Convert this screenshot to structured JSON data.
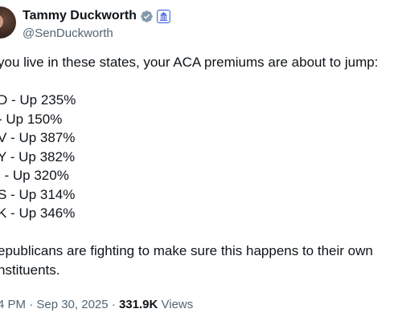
{
  "author": {
    "name": "Tammy Duckworth",
    "handle": "@SenDuckworth"
  },
  "tweet": {
    "intro": "you live in these states, your ACA premiums are about to jump:",
    "states": [
      "D - Up 235%",
      "- Up 150%",
      "V - Up 387%",
      "Y - Up 382%",
      "l - Up 320%",
      "S - Up 314%",
      "K - Up 346%"
    ],
    "closing_line1": "epublicans are fighting to make sure this happens to their own",
    "closing_line2": "nstituents."
  },
  "meta": {
    "time": "4 PM",
    "date": "Sep 30, 2025",
    "separator": "·",
    "views_count": "331.9K",
    "views_label": "Views"
  },
  "colors": {
    "verified_badge": "#829aab",
    "affiliate_badge": "#3b5bdb",
    "text_primary": "#0f1419",
    "text_secondary": "#536471"
  }
}
